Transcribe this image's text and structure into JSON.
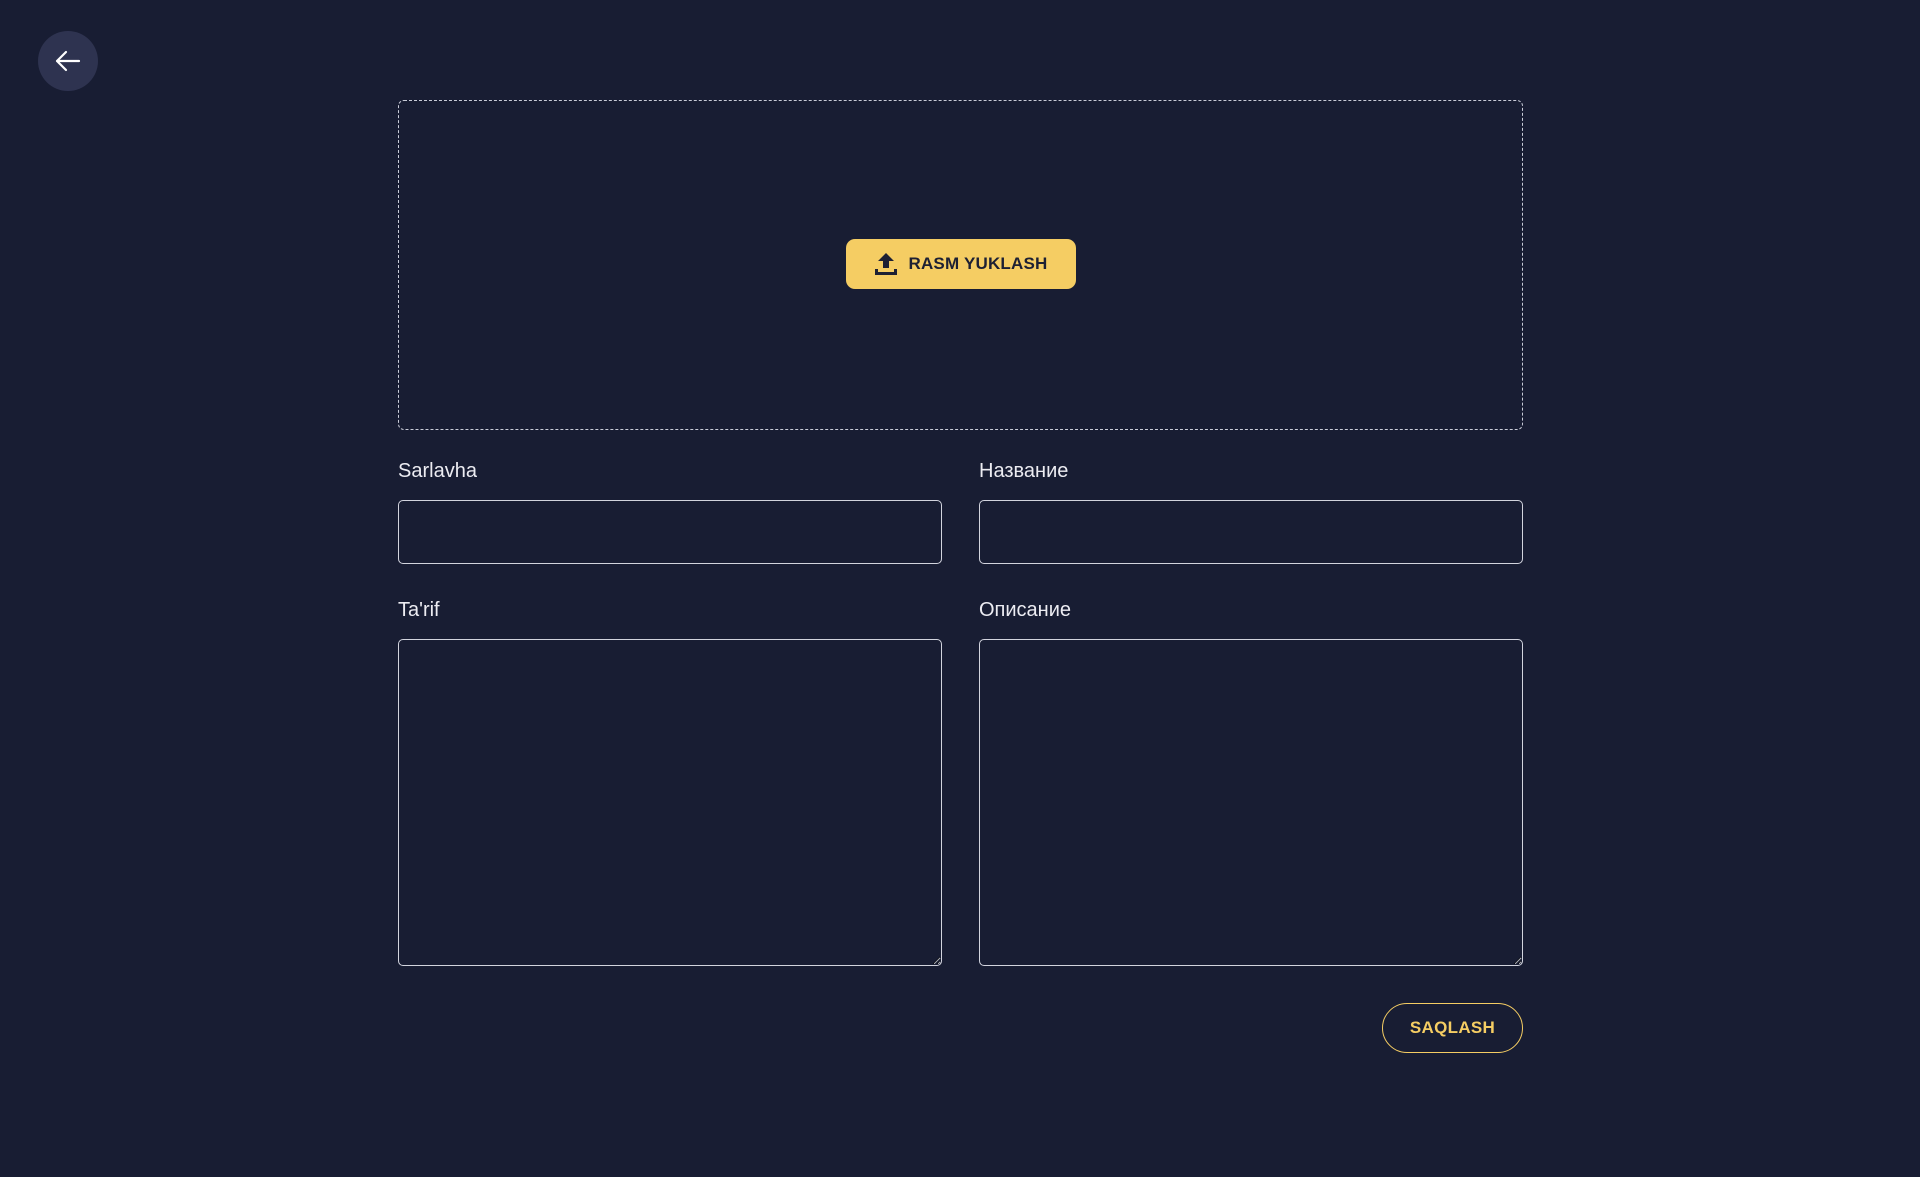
{
  "header": {
    "back_icon": "arrow-left-icon"
  },
  "upload": {
    "button_label": "RASM YUKLASH",
    "icon": "upload-icon"
  },
  "form": {
    "title_uz": {
      "label": "Sarlavha",
      "value": "",
      "placeholder": ""
    },
    "title_ru": {
      "label": "Название",
      "value": "",
      "placeholder": ""
    },
    "description_uz": {
      "label": "Ta'rif",
      "value": "",
      "placeholder": ""
    },
    "description_ru": {
      "label": "Описание",
      "value": "",
      "placeholder": ""
    }
  },
  "actions": {
    "save_label": "SAQLASH"
  },
  "colors": {
    "background": "#181d33",
    "accent": "#f5cd63",
    "back_button_bg": "#2e3350",
    "border": "#d2d4de"
  }
}
